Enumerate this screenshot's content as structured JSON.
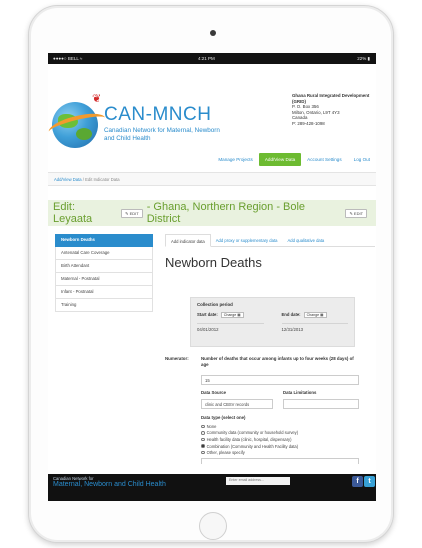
{
  "status_bar": {
    "carrier": "●●●●○ BELL ≈",
    "time": "4:21 PM",
    "battery": "22% ▮"
  },
  "brand": {
    "name": "CAN-MNCH",
    "subtitle": "Canadian Network for Maternal, Newborn and Child Health"
  },
  "org": {
    "name": "Ghana Rural Integrated Development (GRID)",
    "address_lines": [
      "P. O. Box 356",
      "Milton, Ontario, L9T 4Y3",
      "Canada",
      "P: 289-428-1098"
    ]
  },
  "nav": {
    "items": [
      "Manage Projects",
      "Add/View Data",
      "Account Settings",
      "Log Out"
    ],
    "active_index": 1
  },
  "breadcrumb": {
    "link": "Add/View Data",
    "separator": "/",
    "current": "Edit Indicator Data"
  },
  "edit": {
    "title_prefix": "Edit: Leyaata",
    "title_suffix": "- Ghana, Northern Region - Bole District",
    "edit_button": "✎ EDIT"
  },
  "sidebar": {
    "items": [
      "Newborn Deaths",
      "Antenatal Care Coverage",
      "Birth Attendant",
      "Maternal - Postnatal",
      "Infant - Postnatal",
      "Training"
    ],
    "active_index": 0
  },
  "tabs": [
    "Add indicator data",
    "Add proxy or supplementary data",
    "Add qualitative data"
  ],
  "page_title": "Newborn Deaths",
  "collection": {
    "title": "Collection period",
    "start_label": "Start date:",
    "end_label": "End date:",
    "change_label": "Change ▦",
    "start_value": "04/01/2012",
    "end_value": "12/31/2013"
  },
  "numerator": {
    "label": "Numerator:",
    "question": "Number of deaths that occur among infants up to four weeks (28 days) of age",
    "value": "15"
  },
  "data_source": {
    "label": "Data Source",
    "value": "clinic and CBSV records"
  },
  "data_limitations": {
    "label": "Data Limitations",
    "value": ""
  },
  "data_type": {
    "label": "Data type (select one)",
    "options": [
      "None",
      "Community data (community or household survey)",
      "Health facility data (clinic, hospital, dispensary)",
      "Combination (Community and Health Facility data)",
      "Other, please specify"
    ],
    "selected_index": 3
  },
  "footer": {
    "brand_small": "Canadian Network for",
    "brand_big": "Maternal, Newborn and Child Health",
    "email_placeholder": "Enter email address..."
  },
  "colors": {
    "accent": "#2a8ccc",
    "green": "#6dbb31",
    "banner": "#e9f2df"
  }
}
